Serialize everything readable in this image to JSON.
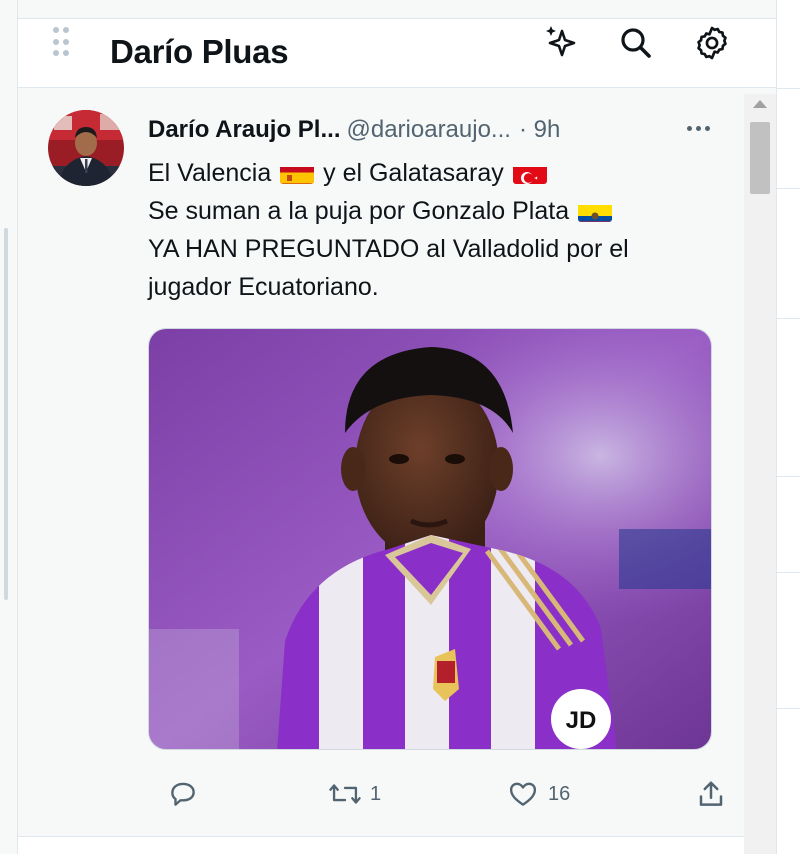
{
  "column": {
    "title": "Darío Pluas"
  },
  "header_icons": [
    "sparkle-icon",
    "search-icon",
    "settings-icon"
  ],
  "tweet": {
    "author_name": "Darío Araujo Pl...",
    "author_handle": "@darioaraujo...",
    "time": "· 9h",
    "lines": [
      {
        "before": "El Valencia ",
        "mid": " y el Galatasaray ",
        "after": ""
      },
      {
        "before": "Se suman a la puja por Gonzalo Plata ",
        "after": ""
      },
      {
        "text": "YA HAN PREGUNTADO al Valladolid por el"
      },
      {
        "text": "jugador Ecuatoriano."
      }
    ],
    "flags": [
      "spain-flag-icon",
      "turkey-flag-icon",
      "ecuador-flag-icon"
    ],
    "media": {
      "jersey_sponsor": "JD"
    },
    "actions": {
      "reply_count": "",
      "retweet_count": "1",
      "like_count": "16"
    }
  },
  "colors": {
    "text_primary": "#0f1419",
    "text_secondary": "#536471",
    "column_bg": "#f7f9f9",
    "jersey_purple": "#8b2fc9"
  }
}
